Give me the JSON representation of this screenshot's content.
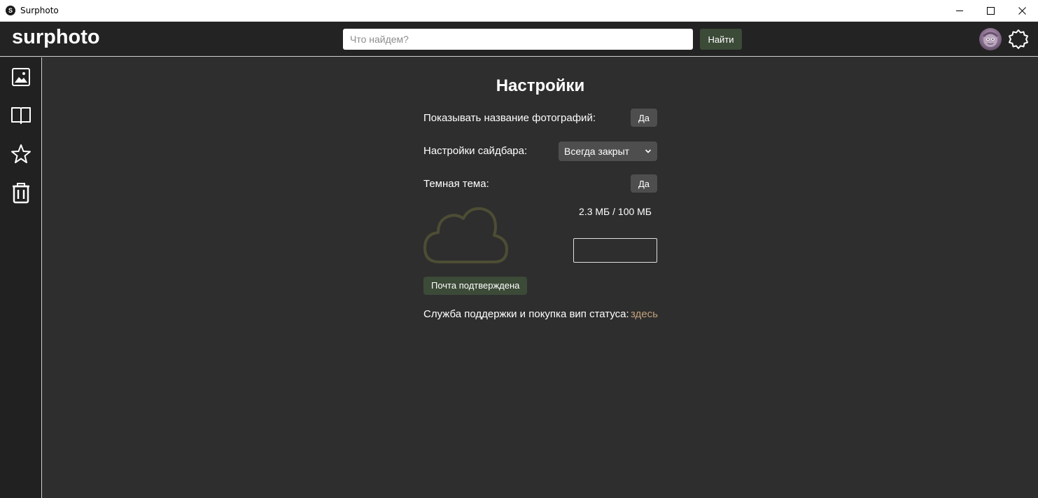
{
  "window": {
    "title": "Surphoto",
    "app_icon_letter": "S"
  },
  "header": {
    "logo": "surphoto",
    "search": {
      "placeholder": "Что найдем?",
      "value": ""
    },
    "search_button": "Найти"
  },
  "sidebar": {
    "items": [
      {
        "icon": "image-icon"
      },
      {
        "icon": "book-icon"
      },
      {
        "icon": "star-icon"
      },
      {
        "icon": "trash-icon"
      }
    ]
  },
  "settings": {
    "title": "Настройки",
    "show_titles": {
      "label": "Показывать название фотографий:",
      "value": "Да"
    },
    "sidebar_setting": {
      "label": "Настройки сайдбара:",
      "selected": "Всегда закрыт"
    },
    "dark_theme": {
      "label": "Темная тема:",
      "value": "Да"
    },
    "storage": {
      "used": "2.3 МБ / 100 МБ"
    },
    "email_status": "Почта подтверждена",
    "support": {
      "label": "Служба поддержки и покупка вип статуса:",
      "link_text": "здесь"
    }
  },
  "colors": {
    "background": "#2e2e2e",
    "header": "#232323",
    "sidebar": "#212121",
    "accent_green": "#3c4a38",
    "cloud_outline": "#4d4d35",
    "link": "#c1a07a",
    "button_gray": "#4e4e4e"
  }
}
